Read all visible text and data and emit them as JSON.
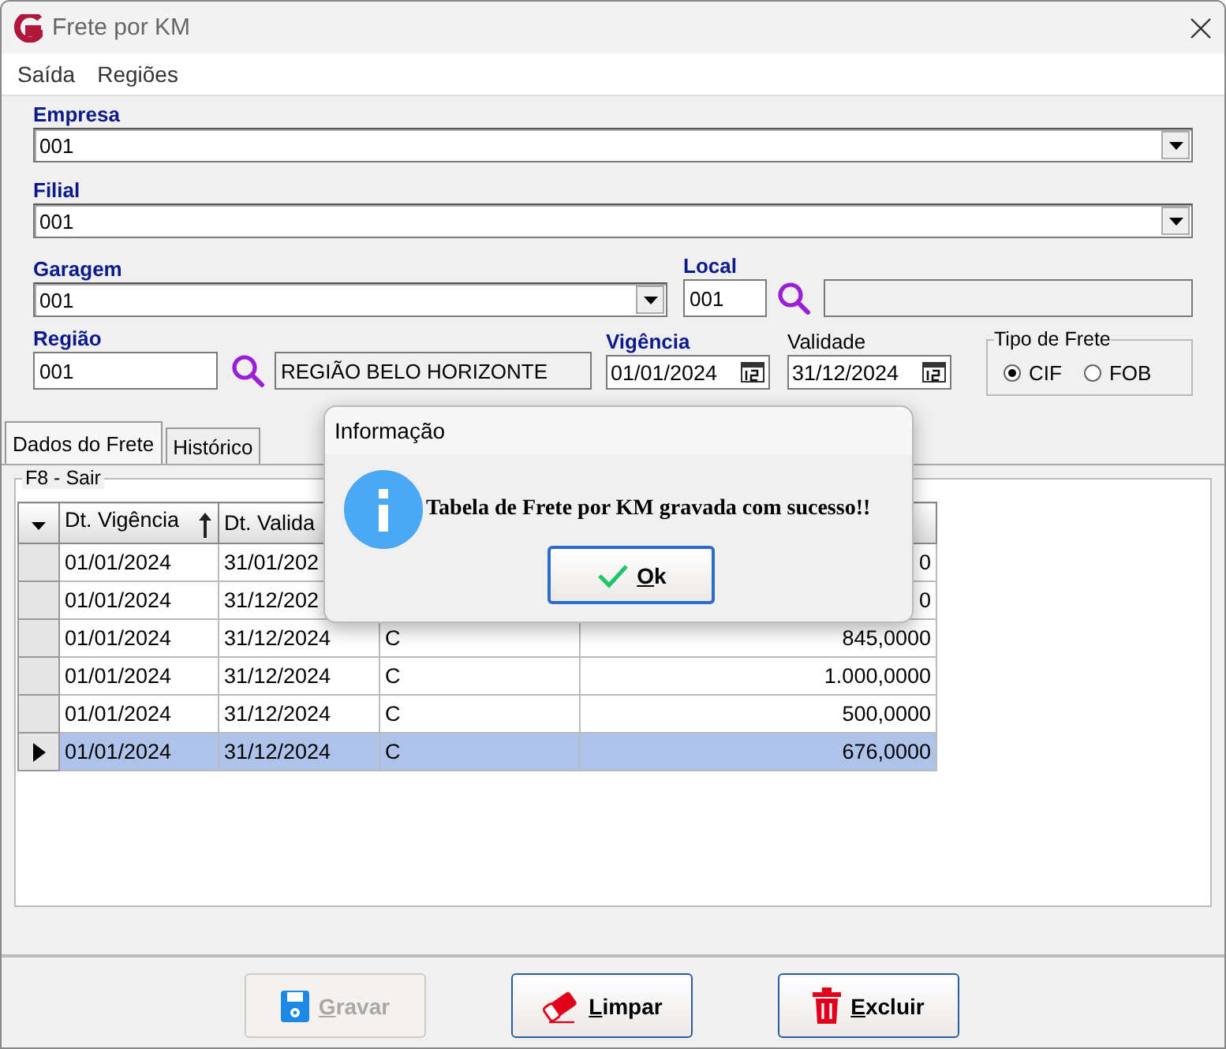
{
  "window": {
    "title": "Frete por KM"
  },
  "menu": [
    {
      "label": "Saída"
    },
    {
      "label": "Regiões"
    }
  ],
  "form": {
    "empresa": {
      "label": "Empresa",
      "value": "001"
    },
    "filial": {
      "label": "Filial",
      "value": "001"
    },
    "garagem": {
      "label": "Garagem",
      "value": "001"
    },
    "local": {
      "label": "Local",
      "value": "001"
    },
    "regiao": {
      "label": "Região",
      "value": "001",
      "description": "REGIÃO BELO HORIZONTE"
    },
    "vigencia": {
      "label": "Vigência",
      "value": "01/01/2024"
    },
    "validade": {
      "label": "Validade",
      "value": "31/12/2024"
    },
    "tipo_frete": {
      "label": "Tipo de Frete",
      "options": [
        {
          "label": "CIF",
          "selected": true
        },
        {
          "label": "FOB",
          "selected": false
        }
      ]
    }
  },
  "tabs": [
    {
      "label": "Dados do Frete",
      "selected": true
    },
    {
      "label": "Histórico",
      "selected": false
    }
  ],
  "group": {
    "label": "F8 - Sair"
  },
  "grid": {
    "columns": [
      {
        "label": "Dt. Vigência",
        "sorted": true
      },
      {
        "label": "Dt. Valida",
        "sorted": false
      }
    ],
    "rows": [
      {
        "cells": [
          "01/01/2024",
          "31/01/202",
          "",
          "0"
        ],
        "selected": false
      },
      {
        "cells": [
          "01/01/2024",
          "31/12/202",
          "",
          "0"
        ],
        "selected": false
      },
      {
        "cells": [
          "01/01/2024",
          "31/12/2024",
          "C",
          "845,0000"
        ],
        "selected": false
      },
      {
        "cells": [
          "01/01/2024",
          "31/12/2024",
          "C",
          "1.000,0000"
        ],
        "selected": false
      },
      {
        "cells": [
          "01/01/2024",
          "31/12/2024",
          "C",
          "500,0000"
        ],
        "selected": false
      },
      {
        "cells": [
          "01/01/2024",
          "31/12/2024",
          "C",
          "676,0000"
        ],
        "selected": true
      }
    ]
  },
  "dialog": {
    "title": "Informação",
    "message": "Tabela de Frete por KM gravada com sucesso!!",
    "button": "Ok"
  },
  "buttons": [
    {
      "label": "Gravar",
      "kind": "save",
      "disabled": true
    },
    {
      "label": "Limpar",
      "kind": "clear",
      "disabled": false
    },
    {
      "label": "Excluir",
      "kind": "delete",
      "disabled": false
    }
  ]
}
